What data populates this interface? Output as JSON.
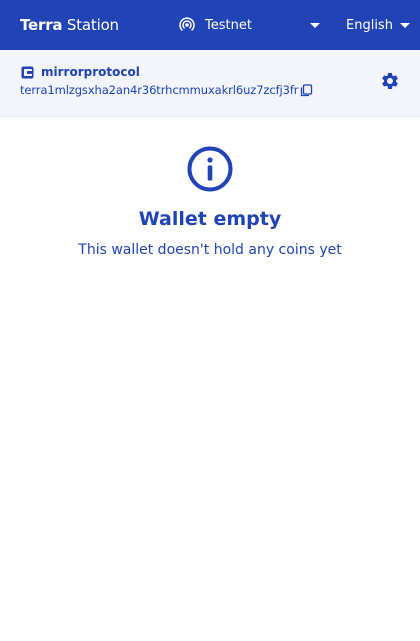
{
  "header": {
    "brand_bold": "Terra",
    "brand_light": "Station",
    "network_label": "Testnet",
    "language_label": "English"
  },
  "wallet": {
    "name": "mirrorprotocol",
    "address": "terra1mlzgsxha2an4r36trhcmmuxakrl6uz7zcfj3fr"
  },
  "empty_state": {
    "title": "Wallet empty",
    "description": "This wallet doesn't hold any coins yet"
  },
  "icons": {
    "network": "broadcast-icon",
    "wallet": "wallet-icon",
    "copy": "copy-icon",
    "settings": "gear-icon",
    "info": "info-icon"
  },
  "colors": {
    "primary": "#2043b5",
    "wallet_bar_bg": "#f2f5fc",
    "background": "#ffffff"
  }
}
